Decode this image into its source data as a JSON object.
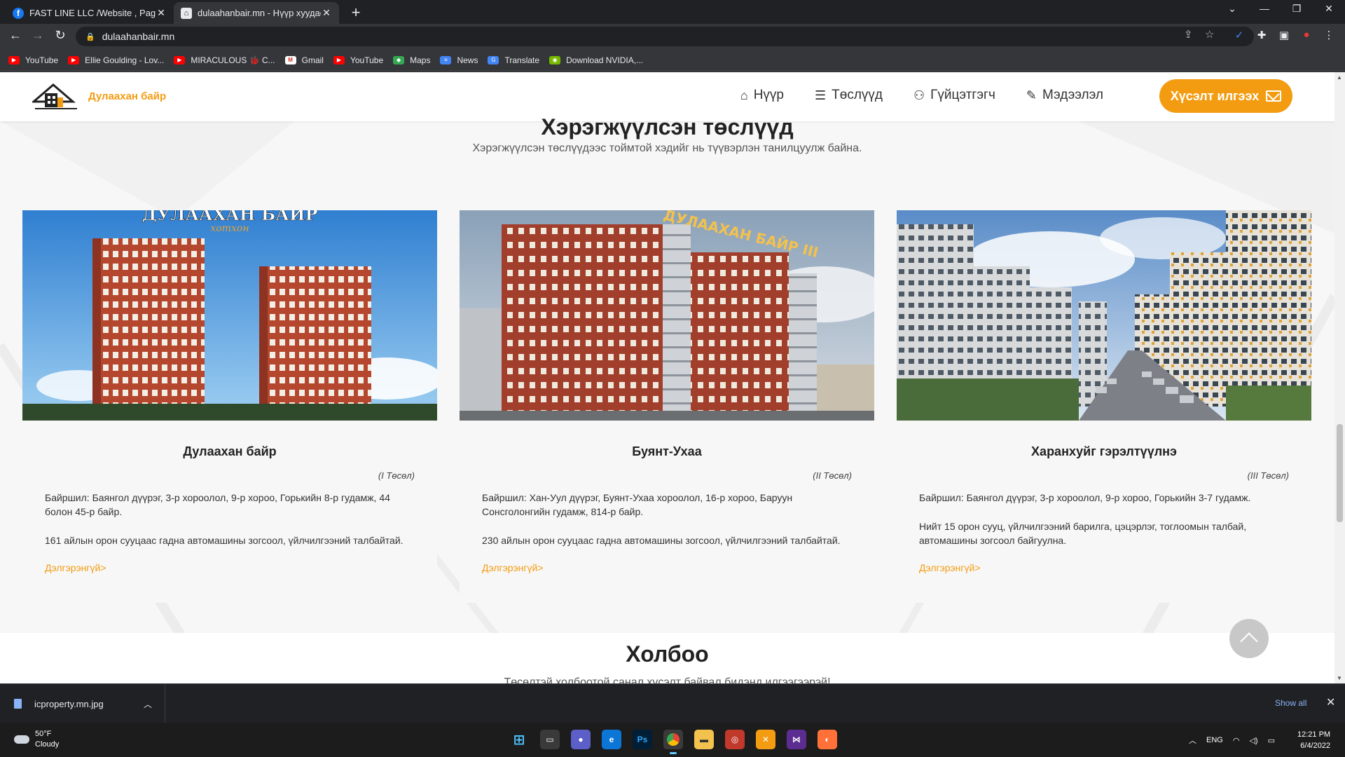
{
  "browser": {
    "tabs": [
      {
        "title": "FAST LINE LLC /Website , Page чадах"
      },
      {
        "title": "dulaahanbair.mn - Нүүр хуудас"
      }
    ],
    "url": "dulaahanbair.mn",
    "bookmarks": [
      {
        "label": "YouTube",
        "icon": "youtube-icon"
      },
      {
        "label": "Ellie Goulding - Lov...",
        "icon": "youtube-icon"
      },
      {
        "label": "MIRACULOUS 🐞 C...",
        "icon": "youtube-icon"
      },
      {
        "label": "Gmail",
        "icon": "gmail-icon"
      },
      {
        "label": "YouTube",
        "icon": "youtube-icon"
      },
      {
        "label": "Maps",
        "icon": "maps-icon"
      },
      {
        "label": "News",
        "icon": "news-icon"
      },
      {
        "label": "Translate",
        "icon": "translate-icon"
      },
      {
        "label": "Download NVIDIA,...",
        "icon": "nvidia-icon"
      }
    ]
  },
  "site": {
    "logo_text": "Дулаахан байр",
    "nav": [
      {
        "label": "Нүүр",
        "icon": "home-icon"
      },
      {
        "label": "Төслүүд",
        "icon": "list-icon"
      },
      {
        "label": "Гүйцэтгэгч",
        "icon": "users-icon"
      },
      {
        "label": "Мэдээлэл",
        "icon": "document-icon"
      }
    ],
    "cta_label": "Хүсэлт илгээх",
    "accent_color": "#f39c12"
  },
  "projects": {
    "title": "Хэрэгжүүлсэн төслүүд",
    "subtitle": "Хэрэгжүүлсэн төслүүдээс тоймтой хэдийг нь түүвэрлэн танилцуулж байна.",
    "cards": [
      {
        "image_sign": "ДУЛААХАН БАЙР",
        "image_sign2": "хотхон",
        "title": "Дулаахан байр",
        "tag": "(I Төсөл)",
        "p1": "Байршил: Баянгол дүүрэг, 3-р хороолол, 9-р хороо, Горькийн 8-р гудамж, 44 болон 45-р байр.",
        "p2": "161 айлын орон сууцаас гадна автомашины зогсоол, үйлчилгээний талбайтай.",
        "link": "Дэлгэрэнгүй>"
      },
      {
        "image_sign": "ДУЛААХАН БАЙР III",
        "title": "Буянт-Ухаа",
        "tag": "(II Төсөл)",
        "p1": "Байршил: Хан-Уул дүүрэг, Буянт-Ухаа хороолол, 16-р хороо, Баруун Сонсголонгийн гудамж, 814-р байр.",
        "p2": "230 айлын орон сууцаас гадна автомашины зогсоол, үйлчилгээний талбайтай.",
        "link": "Дэлгэрэнгүй>"
      },
      {
        "title": "Харанхуйг гэрэлтүүлнэ",
        "tag": "(III Төсөл)",
        "p1": "Байршил: Баянгол дүүрэг, 3-р хороолол, 9-р хороо, Горькийн 3-7 гудамж.",
        "p2": "Нийт 15 орон сууц, үйлчилгээний барилга, цэцэрлэг, тоглоомын талбай, автомашины зогсоол байгуулна.",
        "link": "Дэлгэрэнгүй>"
      }
    ]
  },
  "contact": {
    "title": "Холбоо",
    "subtitle": "Төсөлтэй холбоотой санал хүсэлт байвал бидэнд илгээгээрэй!"
  },
  "download_bar": {
    "file": "icproperty.mn.jpg",
    "show_all": "Show all"
  },
  "taskbar": {
    "temperature": "50°F",
    "weather": "Cloudy",
    "lang": "ENG",
    "time": "12:21 PM",
    "date": "6/4/2022"
  }
}
